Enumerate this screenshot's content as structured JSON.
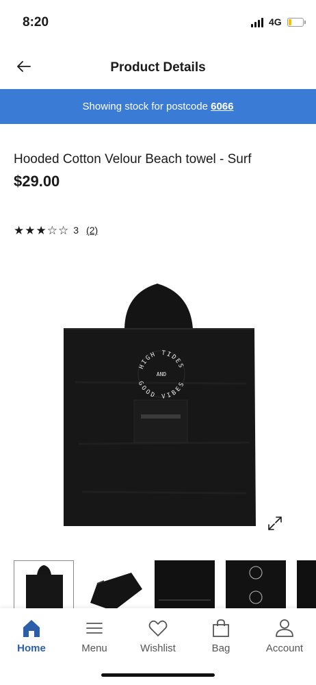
{
  "status_bar": {
    "time": "8:20",
    "network": "4G"
  },
  "header": {
    "title": "Product Details"
  },
  "banner": {
    "text": "Showing stock for postcode ",
    "postcode": "6066"
  },
  "product": {
    "name": "Hooded Cotton Velour Beach towel  - Surf",
    "price": "$29.00",
    "rating": {
      "value": "3",
      "review_count": "(2)",
      "stars_filled": 3,
      "stars_total": 5
    },
    "print_text": {
      "top": "HIGH TIDES",
      "middle": "AND",
      "bottom": "GOOD VIBES"
    }
  },
  "nav": {
    "items": [
      {
        "label": "Home",
        "active": true
      },
      {
        "label": "Menu"
      },
      {
        "label": "Wishlist"
      },
      {
        "label": "Bag"
      },
      {
        "label": "Account"
      }
    ]
  },
  "colors": {
    "accent": "#3a7bd5",
    "nav_active": "#2d5fa8"
  }
}
